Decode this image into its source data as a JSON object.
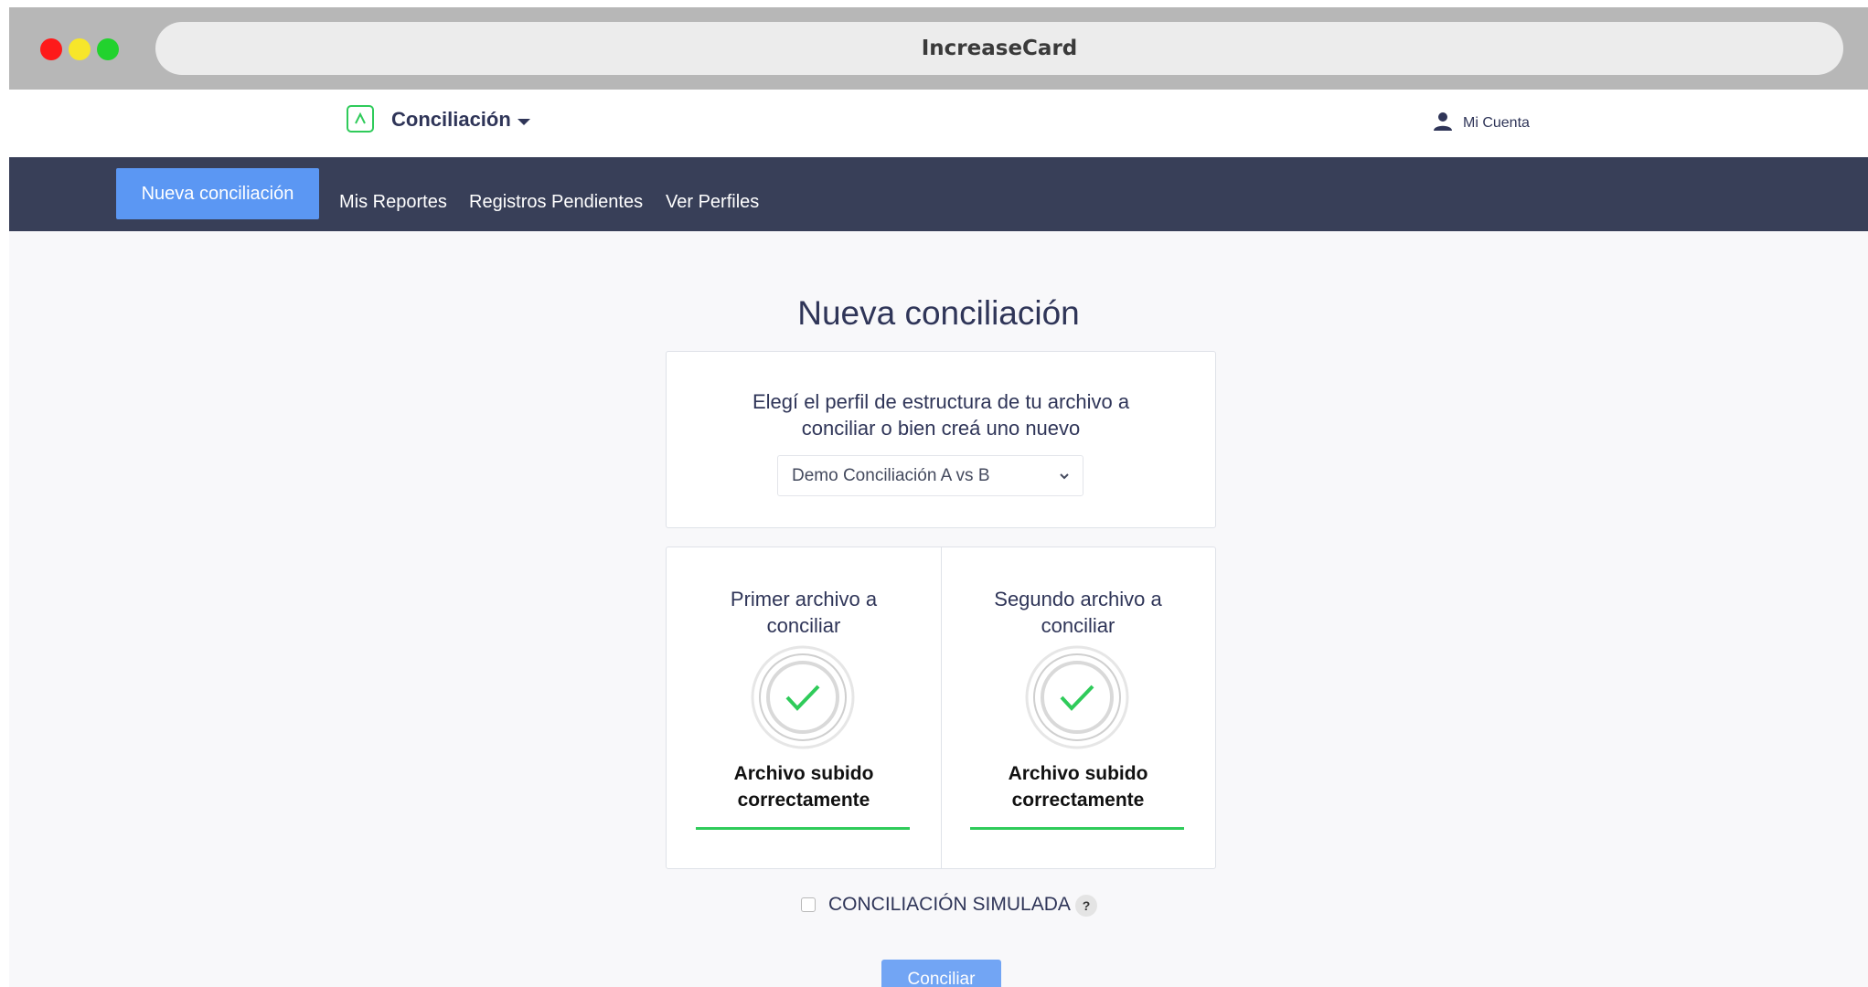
{
  "browser": {
    "title": "IncreaseCard"
  },
  "header": {
    "brand": "Conciliación",
    "account_label": "Mi Cuenta"
  },
  "nav": {
    "items": [
      {
        "label": "Nueva conciliación",
        "active": true
      },
      {
        "label": "Mis Reportes",
        "active": false
      },
      {
        "label": "Registros Pendientes",
        "active": false
      },
      {
        "label": "Ver Perfiles",
        "active": false
      }
    ]
  },
  "main": {
    "title": "Nueva conciliación",
    "profile": {
      "prompt_line1": "Elegí el perfil de estructura de tu archivo a",
      "prompt_line2": "conciliar o bien creá uno nuevo",
      "selected": "Demo Conciliación A vs B"
    },
    "files": [
      {
        "title_line1": "Primer archivo a",
        "title_line2": "conciliar",
        "status_line1": "Archivo subido",
        "status_line2": "correctamente"
      },
      {
        "title_line1": "Segundo archivo a",
        "title_line2": "conciliar",
        "status_line1": "Archivo subido",
        "status_line2": "correctamente"
      }
    ],
    "simulated": {
      "label": "CONCILIACIÓN SIMULADA",
      "checked": false,
      "help": "?"
    },
    "submit_label": "Conciliar"
  },
  "colors": {
    "navbar": "#383f58",
    "accent": "#5b97f3",
    "success": "#2fcb5a",
    "text": "#2f3558"
  },
  "icons": [
    "logo-icon",
    "caret-down-icon",
    "user-icon",
    "chevron-down-icon",
    "check-circle-icon",
    "help-icon"
  ]
}
